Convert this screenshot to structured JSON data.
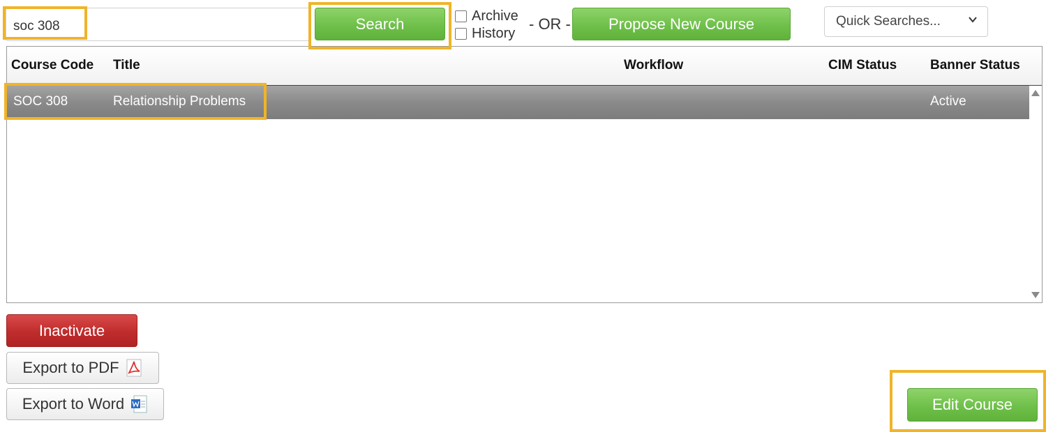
{
  "search": {
    "value": "soc 308",
    "button_label": "Search"
  },
  "filters": {
    "archive_label": "Archive",
    "history_label": "History"
  },
  "or_text": "- OR -",
  "propose_button_label": "Propose New Course",
  "quick_searches": {
    "selected": "Quick Searches..."
  },
  "table": {
    "columns": [
      "Course Code",
      "Title",
      "Workflow",
      "CIM Status",
      "Banner Status"
    ],
    "rows": [
      {
        "course_code": "SOC 308",
        "title": "Relationship Problems",
        "workflow": "",
        "cim_status": "",
        "banner_status": "Active"
      }
    ]
  },
  "actions": {
    "inactivate_label": "Inactivate",
    "export_pdf_label": "Export to PDF",
    "export_word_label": "Export to Word",
    "edit_course_label": "Edit Course"
  },
  "icons": {
    "pdf": "pdf-icon",
    "word": "word-icon",
    "dropdown": "chevron-down-icon"
  },
  "colors": {
    "green_button": "#6fc04a",
    "red_button": "#c02c2c",
    "highlight": "#f0b429",
    "selected_row": "#8a8a8a"
  }
}
